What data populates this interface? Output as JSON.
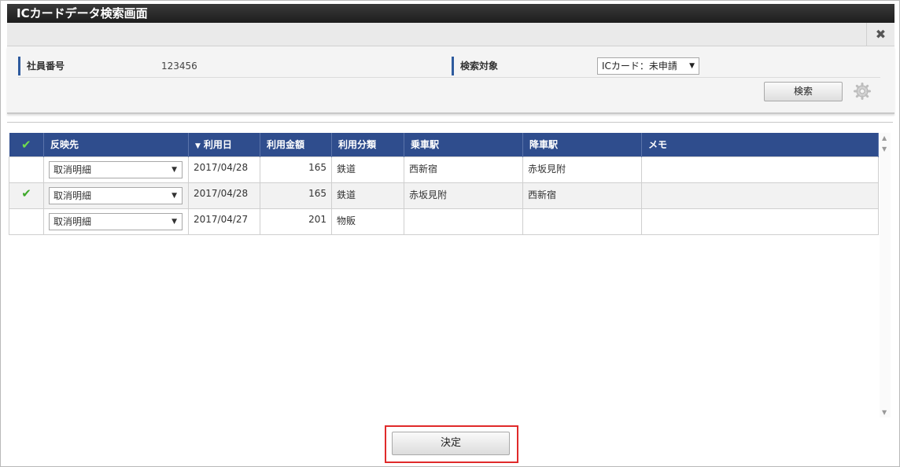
{
  "window": {
    "title": "ICカードデータ検索画面"
  },
  "toolbar": {
    "close_icon": "close-icon"
  },
  "search": {
    "employee_label": "社員番号",
    "employee_value": "123456",
    "target_label": "検索対象",
    "target_value": "ICカード：未申請",
    "search_button": "検索",
    "settings_icon": "gear-icon"
  },
  "table": {
    "headers": [
      "反映先",
      "利用日",
      "利用金額",
      "利用分類",
      "乗車駅",
      "降車駅",
      "メモ"
    ],
    "rows": [
      {
        "checked": "",
        "dest": "取消明細",
        "date": "2017/04/28",
        "amount": "165",
        "category": "鉄道",
        "from": "西新宿",
        "to": "赤坂見附",
        "memo": ""
      },
      {
        "checked": "✔",
        "dest": "取消明細",
        "date": "2017/04/28",
        "amount": "165",
        "category": "鉄道",
        "from": "赤坂見附",
        "to": "西新宿",
        "memo": ""
      },
      {
        "checked": "",
        "dest": "取消明細",
        "date": "2017/04/27",
        "amount": "201",
        "category": "物販",
        "from": "",
        "to": "",
        "memo": ""
      }
    ]
  },
  "footer": {
    "decide_button": "決定"
  },
  "colors": {
    "titlebar": "#1d1d1d",
    "header": "#2f4d8d",
    "check": "#3ea92a",
    "highlight": "#e02a2a"
  }
}
